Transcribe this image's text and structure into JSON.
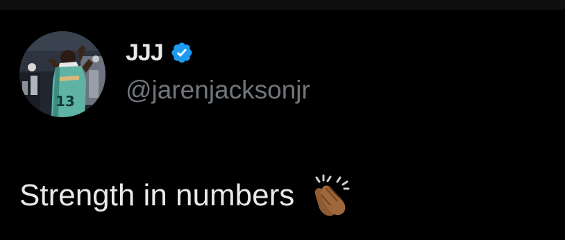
{
  "author": {
    "display_name": "JJJ",
    "handle": "@jarenjacksonjr",
    "verified": true,
    "verified_color": "#1d9bf0",
    "avatar": "profile-photo"
  },
  "tweet": {
    "text": "Strength in numbers",
    "emoji": "clapping-hands-medium-dark-skin-tone"
  },
  "theme": {
    "background": "#000000",
    "text_primary": "#e7e9ea",
    "text_secondary": "#71767b"
  }
}
